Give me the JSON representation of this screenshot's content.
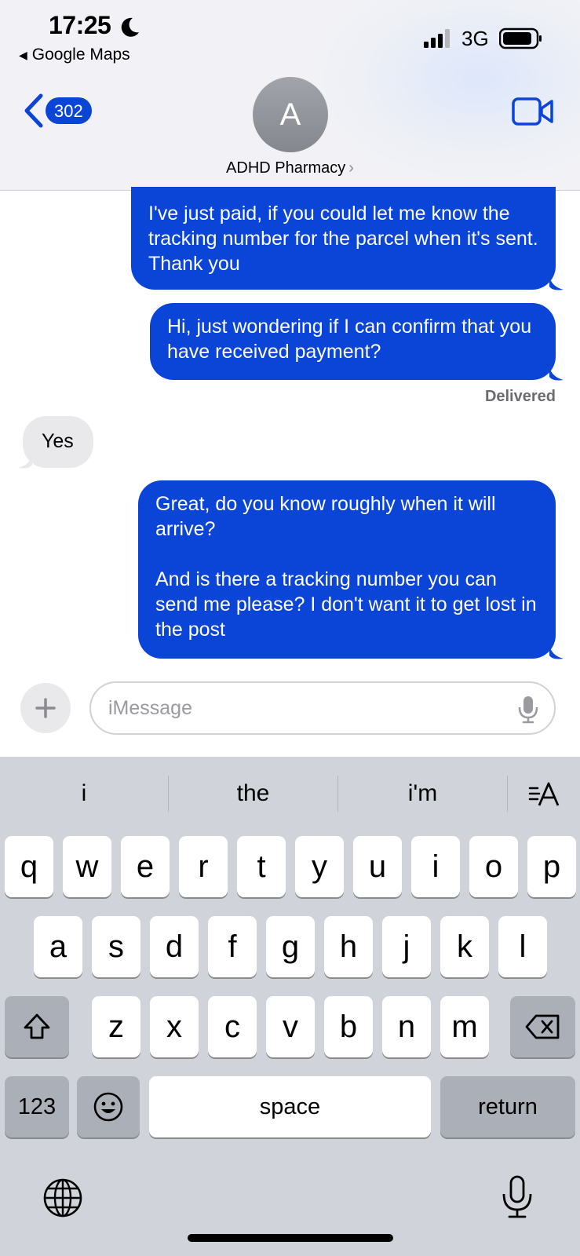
{
  "status_bar": {
    "time": "17:25",
    "back_app": "Google Maps",
    "network": "3G",
    "icons": [
      "moon-icon",
      "signal-icon",
      "battery-icon"
    ]
  },
  "nav": {
    "back_count": "302",
    "avatar_initial": "A",
    "contact_name": "ADHD Pharmacy",
    "contact_chevron": "›",
    "icons": [
      "chevron-left-icon",
      "video-camera-icon"
    ]
  },
  "messages": [
    {
      "direction": "outgoing",
      "text": "I've just paid, if you could let me know the tracking number for the parcel when it's sent. Thank you"
    },
    {
      "direction": "outgoing",
      "text": "Hi, just wondering if I can confirm that you have received payment?"
    },
    {
      "direction": "incoming",
      "text": "Yes"
    },
    {
      "direction": "outgoing",
      "text": "Great, do you know roughly when it will arrive?\n\nAnd is there a tracking number you can send me please? I don't want it to get lost in the post"
    }
  ],
  "delivered_label": "Delivered",
  "composer": {
    "placeholder": "iMessage",
    "icons": [
      "plus-icon",
      "microphone-icon"
    ]
  },
  "keyboard": {
    "suggestions": [
      "i",
      "the",
      "i'm"
    ],
    "text_format_icon": "text-format-icon",
    "row1": [
      "q",
      "w",
      "e",
      "r",
      "t",
      "y",
      "u",
      "i",
      "o",
      "p"
    ],
    "row2": [
      "a",
      "s",
      "d",
      "f",
      "g",
      "h",
      "j",
      "k",
      "l"
    ],
    "row3": [
      "z",
      "x",
      "c",
      "v",
      "b",
      "n",
      "m"
    ],
    "numbers_label": "123",
    "space_label": "space",
    "return_label": "return",
    "icons": [
      "shift-icon",
      "delete-icon",
      "emoji-icon",
      "globe-icon",
      "dictation-mic-icon"
    ]
  },
  "colors": {
    "outgoing_bubble": "#0a45d8",
    "incoming_bubble": "#e9e9eb",
    "badge": "#0b45d8",
    "keyboard_bg": "#d0d3d9"
  }
}
